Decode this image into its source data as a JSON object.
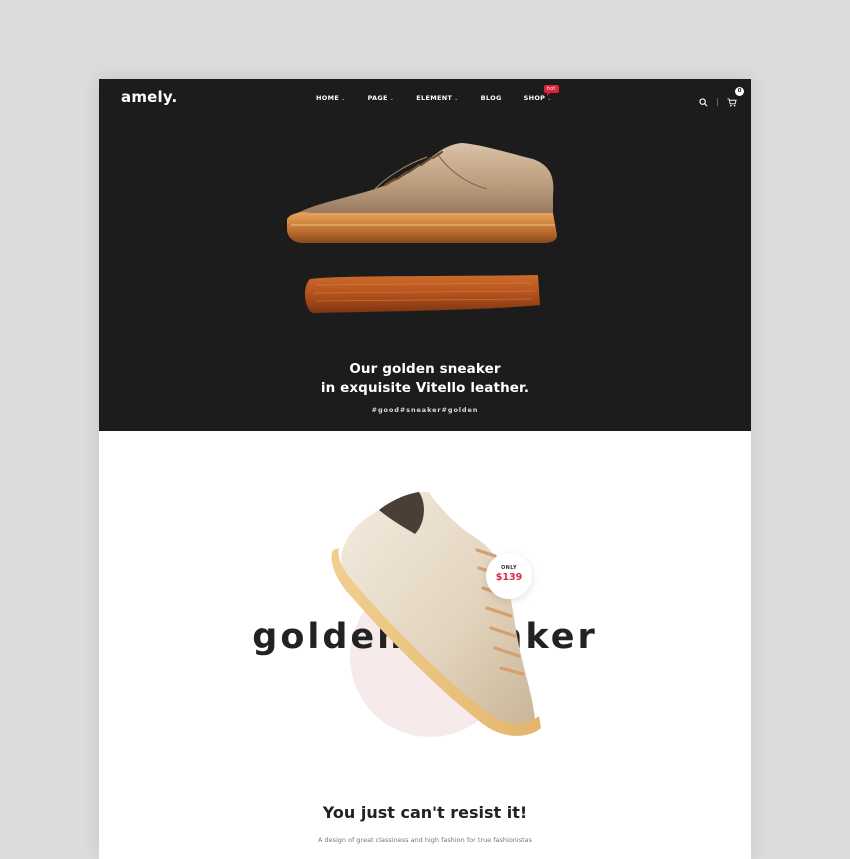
{
  "header": {
    "logo": "amely.",
    "nav": [
      {
        "label": "HOME",
        "has_dropdown": true
      },
      {
        "label": "PAGE",
        "has_dropdown": true
      },
      {
        "label": "ELEMENT",
        "has_dropdown": true
      },
      {
        "label": "BLOG",
        "has_dropdown": false
      },
      {
        "label": "SHOP",
        "has_dropdown": true,
        "badge": "hot"
      }
    ],
    "icons": {
      "search": "search-icon",
      "cart": "cart-icon"
    },
    "cart_count": "0"
  },
  "hero": {
    "title_line1": "Our golden sneaker",
    "title_line2": "in exquisite Vitello leather.",
    "tags": "#good#sneaker#golden"
  },
  "product": {
    "big_title": "golden sneaker",
    "price_prefix": "ONLY",
    "price": "$139",
    "headline": "You just can't resist it!",
    "description": "A design of great classiness and high fashion for true fashionistas"
  },
  "colors": {
    "hero_bg": "#1c1c1c",
    "accent_red": "#e0203a",
    "price_red": "#d92b4a",
    "brush_orange": "#b3521d"
  }
}
